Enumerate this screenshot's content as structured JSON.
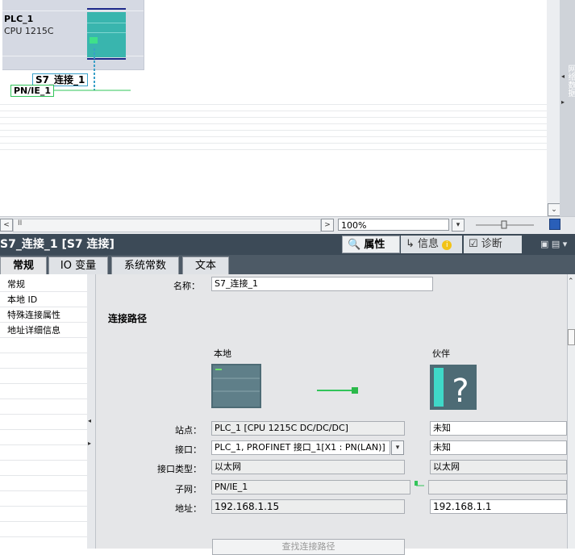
{
  "canvas": {
    "plc_name": "PLC_1",
    "plc_type": "CPU 1215C",
    "connection_label": "S7_连接_1",
    "network_label": "PN/IE_1",
    "side_tab": "网络数据"
  },
  "canvas_bar": {
    "scroll_left": "<",
    "scroll_thumb": "II",
    "scroll_right": ">",
    "zoom": "100%"
  },
  "inspector": {
    "title": "S7_连接_1 [S7 连接]",
    "tabs": {
      "properties": "属性",
      "info": "信息",
      "diagnostics": "诊断"
    },
    "sub_tabs": [
      "常规",
      "IO 变量",
      "系统常数",
      "文本"
    ]
  },
  "nav": {
    "items": [
      "常规",
      "本地 ID",
      "特殊连接属性",
      "地址详细信息"
    ]
  },
  "general": {
    "name_label": "名称：",
    "name_value": "S7_连接_1",
    "section_title": "连接路径",
    "local_header": "本地",
    "partner_header": "伙伴",
    "station_label": "站点：",
    "station_local": "PLC_1 [CPU 1215C DC/DC/DC]",
    "station_partner": "未知",
    "interface_label": "接口：",
    "interface_local": "PLC_1, PROFINET 接口_1[X1 : PN(LAN)]",
    "interface_partner": "未知",
    "iftype_label": "接口类型：",
    "iftype_local": "以太网",
    "iftype_partner": "以太网",
    "subnet_label": "子网：",
    "subnet_local": "PN/IE_1",
    "subnet_partner": "",
    "address_label": "地址：",
    "address_local": "192.168.1.15",
    "address_partner": "192.168.1.1",
    "find_button": "查找连接路径"
  },
  "colors": {
    "header_bg": "#3c4a57",
    "accent_green": "#32c45a",
    "module_teal": "#3ab8b2"
  }
}
